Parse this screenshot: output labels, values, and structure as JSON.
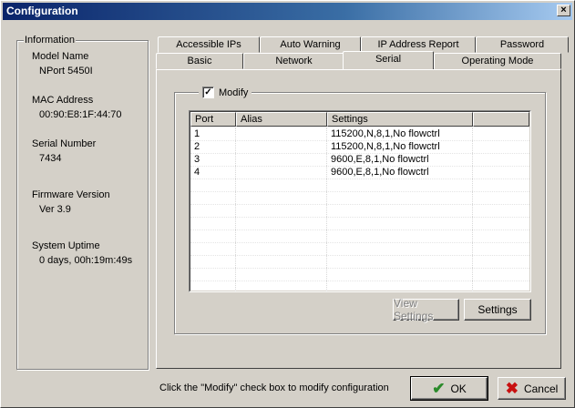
{
  "window": {
    "title": "Configuration",
    "close_glyph": "×"
  },
  "info": {
    "legend": "Information",
    "fields": [
      {
        "label": "Model Name",
        "value": "NPort 5450I"
      },
      {
        "label": "MAC Address",
        "value": "00:90:E8:1F:44:70"
      },
      {
        "label": "Serial Number",
        "value": "7434"
      },
      {
        "label": "Firmware Version",
        "value": "Ver 3.9"
      },
      {
        "label": "System Uptime",
        "value": "0 days, 00h:19m:49s"
      }
    ]
  },
  "tabs": {
    "row1": [
      "Accessible IPs",
      "Auto Warning",
      "IP Address Report",
      "Password"
    ],
    "row2": [
      "Basic",
      "Network",
      "Serial",
      "Operating Mode"
    ],
    "active": "Serial"
  },
  "serial": {
    "modify_label": "Modify",
    "modify_checked": true,
    "check_glyph": "✓",
    "columns": [
      "Port",
      "Alias",
      "Settings",
      ""
    ],
    "rows": [
      {
        "port": "1",
        "alias": "",
        "settings": "115200,N,8,1,No flowctrl"
      },
      {
        "port": "2",
        "alias": "",
        "settings": "115200,N,8,1,No flowctrl"
      },
      {
        "port": "3",
        "alias": "",
        "settings": "9600,E,8,1,No flowctrl"
      },
      {
        "port": "4",
        "alias": "",
        "settings": "9600,E,8,1,No flowctrl"
      }
    ],
    "view_settings_label": "View Settings",
    "settings_label": "Settings"
  },
  "footer": {
    "hint": "Click the \"Modify\" check box to modify configuration",
    "ok_label": "OK",
    "cancel_label": "Cancel",
    "ok_icon": "✔",
    "cancel_icon": "✖"
  },
  "colors": {
    "titlebar_start": "#0a246a",
    "face": "#d4d0c8",
    "ok_icon": "#2a8a2a",
    "cancel_icon": "#c81010"
  }
}
